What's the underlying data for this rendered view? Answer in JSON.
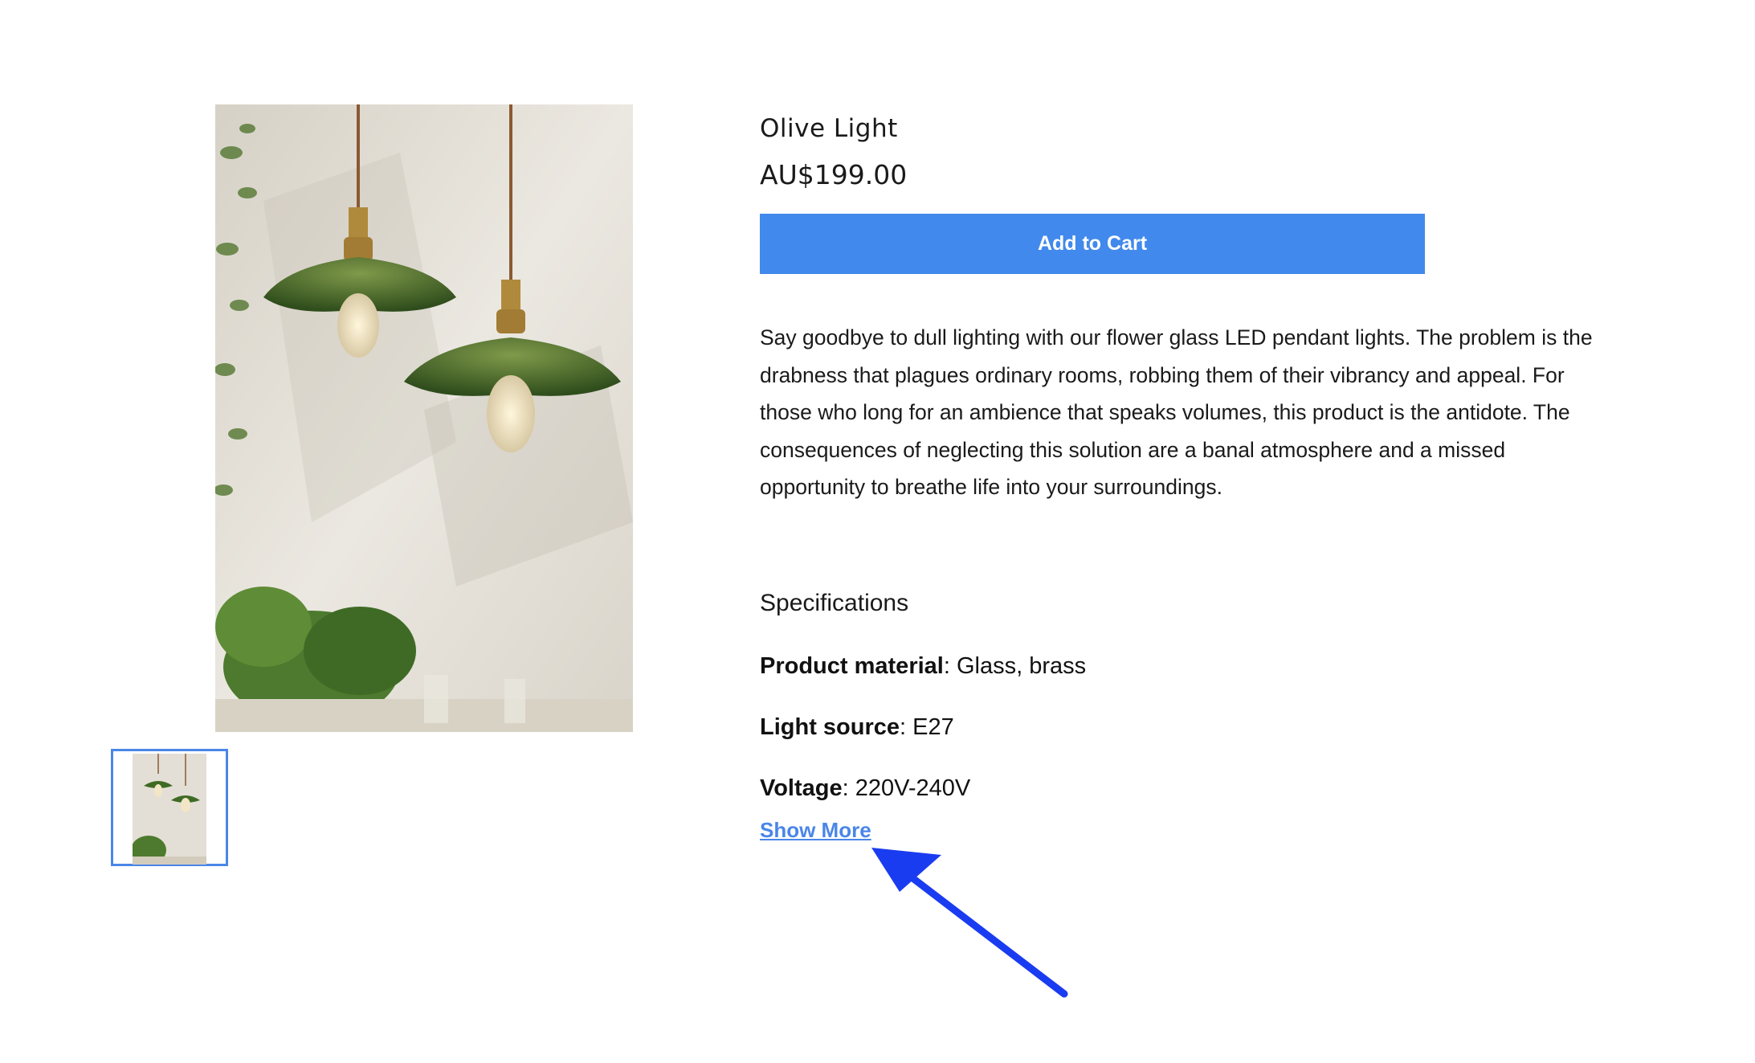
{
  "product": {
    "title": "Olive Light",
    "price": "AU$199.00",
    "add_to_cart_label": "Add to Cart",
    "description": "Say goodbye to dull lighting with our flower glass LED pendant lights. The problem is the drabness that plagues ordinary rooms, robbing them of their vibrancy and appeal. For those who long for an ambience that speaks volumes, this product is the antidote. The consequences of neglecting this solution are a banal atmosphere and a missed opportunity to breathe life into your surroundings."
  },
  "specifications": {
    "heading": "Specifications",
    "items": [
      {
        "label": "Product material",
        "value": ": Glass, brass"
      },
      {
        "label": "Light source",
        "value": ": E27"
      },
      {
        "label": "Voltage",
        "value": ": 220V-240V"
      }
    ],
    "show_more_label": "Show More"
  },
  "colors": {
    "accent": "#4189ec",
    "link": "#4a86e8",
    "annotation_arrow": "#1a3cf0"
  },
  "icons": {
    "gallery_thumbnail": "pendant-lights-thumbnail-icon",
    "annotation": "arrow-pointer-icon"
  }
}
